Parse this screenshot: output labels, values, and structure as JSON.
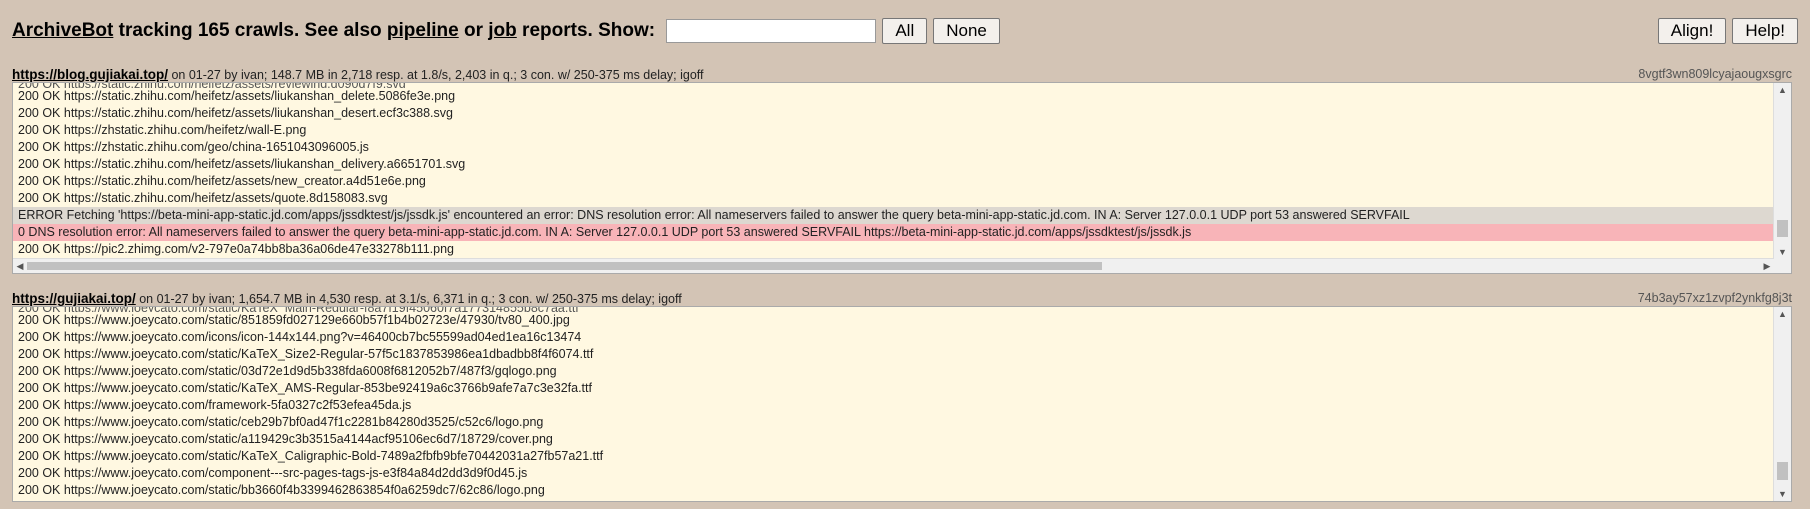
{
  "header": {
    "brand": "ArchiveBot",
    "tracking_text": " tracking 165 crawls. See also ",
    "pipeline_link": "pipeline",
    "or_text": " or ",
    "job_link": "job",
    "reports_text": " reports. Show: ",
    "filter_value": "",
    "all_button": "All",
    "none_button": "None",
    "align_button": "Align!",
    "help_button": "Help!"
  },
  "jobs": [
    {
      "url": "https://blog.gujiakai.top/",
      "info": " on 01-27 by ivan; 148.7 MB in 2,718 resp. at 1.8/s, 2,403 in q.; 3 con. w/ 250-375 ms delay; igoff",
      "ident": "8vgtf3wn809lcyajaougxsgrc",
      "partial_line": "200 OK https://static.zhihu.com/heifetz/assets/reviewing.d090d7f9.svg",
      "lines": [
        "200 OK https://static.zhihu.com/heifetz/assets/liukanshan_delete.5086fe3e.png",
        "200 OK https://static.zhihu.com/heifetz/assets/liukanshan_desert.ecf3c388.svg",
        "200 OK https://zhstatic.zhihu.com/heifetz/wall-E.png",
        "200 OK https://zhstatic.zhihu.com/geo/china-1651043096005.js",
        "200 OK https://static.zhihu.com/heifetz/assets/liukanshan_delivery.a6651701.svg",
        "200 OK https://static.zhihu.com/heifetz/assets/new_creator.a4d51e6e.png",
        "200 OK https://static.zhihu.com/heifetz/assets/quote.8d158083.svg"
      ],
      "error_line": "ERROR Fetching 'https://beta-mini-app-static.jd.com/apps/jssdktest/js/jssdk.js' encountered an error: DNS resolution error: All nameservers failed to answer the query beta-mini-app-static.jd.com. IN A: Server 127.0.0.1 UDP port 53 answered SERVFAIL",
      "fail_line": "0 DNS resolution error: All nameservers failed to answer the query beta-mini-app-static.jd.com. IN A: Server 127.0.0.1 UDP port 53 answered SERVFAIL https://beta-mini-app-static.jd.com/apps/jssdktest/js/jssdk.js",
      "last_line": "200 OK https://pic2.zhimg.com/v2-797e0a74bb8ba36a06de47e33278b111.png"
    },
    {
      "url": "https://gujiakai.top/",
      "info": " on 01-27 by ivan; 1,654.7 MB in 4,530 resp. at 3.1/s, 6,371 in q.; 3 con. w/ 250-375 ms delay; igoff",
      "ident": "74b3ay57xz1zvpf2ynkfg8j3t",
      "partial_line": "200 OK https://www.joeycato.com/static/KaTeX_Main-Regular-f8a7f19f45060f7a177314855b8c7aa.ttf",
      "lines": [
        "200 OK https://www.joeycato.com/static/851859fd027129e660b57f1b4b02723e/47930/tv80_400.jpg",
        "200 OK https://www.joeycato.com/icons/icon-144x144.png?v=46400cb7bc55599ad04ed1ea16c13474",
        "200 OK https://www.joeycato.com/static/KaTeX_Size2-Regular-57f5c1837853986ea1dbadbb8f4f6074.ttf",
        "200 OK https://www.joeycato.com/static/03d72e1d9d5b338fda6008f6812052b7/487f3/gqlogo.png",
        "200 OK https://www.joeycato.com/static/KaTeX_AMS-Regular-853be92419a6c3766b9afe7a7c3e32fa.ttf",
        "200 OK https://www.joeycato.com/framework-5fa0327c2f53efea45da.js",
        "200 OK https://www.joeycato.com/static/ceb29b7bf0ad47f1c2281b84280d3525/c52c6/logo.png",
        "200 OK https://www.joeycato.com/static/a119429c3b3515a4144acf95106ec6d7/18729/cover.png",
        "200 OK https://www.joeycato.com/static/KaTeX_Caligraphic-Bold-7489a2fbfb9bfe70442031a27fb57a21.ttf",
        "200 OK https://www.joeycato.com/component---src-pages-tags-js-e3f84a84d2dd3d9f0d45.js",
        "200 OK https://www.joeycato.com/static/bb3660f4b3399462863854f0a6259dc7/62c86/logo.png"
      ]
    }
  ]
}
